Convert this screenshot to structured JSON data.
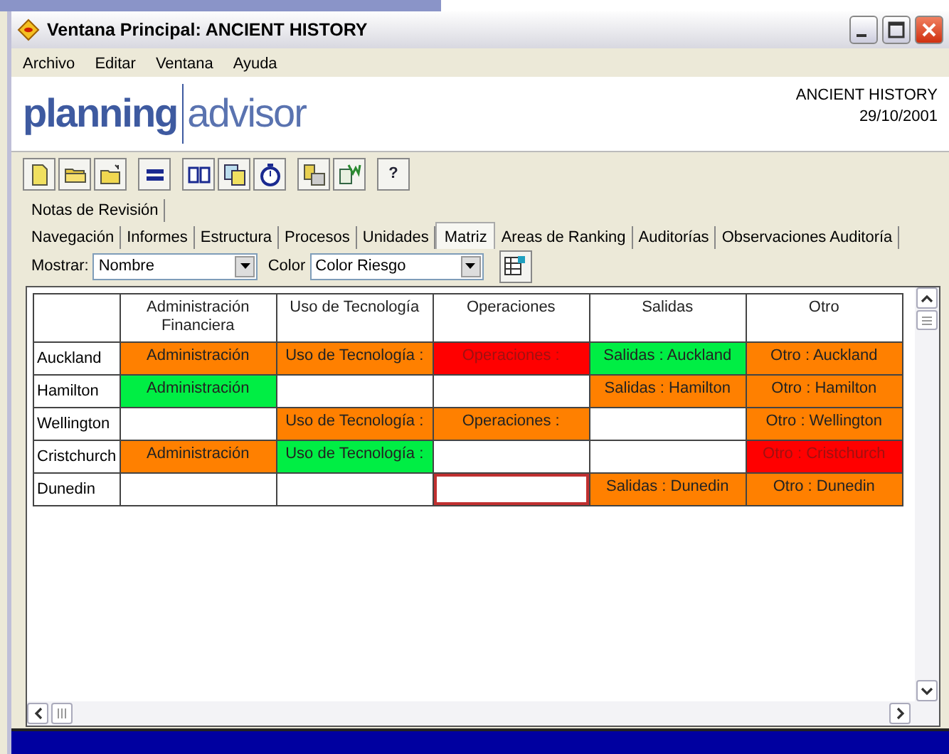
{
  "window": {
    "title": "Ventana Principal: ANCIENT HISTORY"
  },
  "menu": [
    "Archivo",
    "Editar",
    "Ventana",
    "Ayuda"
  ],
  "logo": {
    "left": "planning",
    "right": "advisor"
  },
  "header_info": [
    "ANCIENT HISTORY",
    "29/10/2001"
  ],
  "toolbar": [
    {
      "kind": "icon"
    },
    {
      "kind": "icon"
    },
    {
      "kind": "icon"
    },
    {
      "kind": "icon"
    },
    {
      "kind": "icon"
    },
    {
      "kind": "icon"
    },
    {
      "kind": "icon"
    },
    {
      "kind": "icon"
    },
    {
      "kind": "icon"
    },
    {
      "kind": "text",
      "label": "?"
    }
  ],
  "tabs_row1": [
    {
      "label": "Notas de Revisión",
      "selected": false
    }
  ],
  "tabs_row2": [
    {
      "label": "Navegación",
      "selected": false
    },
    {
      "label": "Informes",
      "selected": false
    },
    {
      "label": "Estructura",
      "selected": false
    },
    {
      "label": "Procesos",
      "selected": false
    },
    {
      "label": "Unidades",
      "selected": false
    },
    {
      "label": "Matriz",
      "selected": true
    },
    {
      "label": "Areas de Ranking",
      "selected": false
    },
    {
      "label": "Auditorías",
      "selected": false
    },
    {
      "label": "Observaciones Auditoría",
      "selected": false
    }
  ],
  "filters": {
    "show_label": "Mostrar:",
    "show_value": "Nombre",
    "color_label": "Color",
    "color_value": "Color Riesgo"
  },
  "matrix": {
    "columns": [
      "Administración Financiera",
      "Uso de Tecnología",
      "Operaciones",
      "Salidas",
      "Otro"
    ],
    "rows": [
      {
        "label": "Auckland",
        "cells": [
          {
            "text": "Administración",
            "color": "#ff8000",
            "selected": false
          },
          {
            "text": "Uso de Tecnología :",
            "color": "#ff8000",
            "selected": false
          },
          {
            "text": "Operaciones :",
            "color": "#ff0000",
            "selected": false
          },
          {
            "text": "Salidas : Auckland",
            "color": "#00ee44",
            "selected": false
          },
          {
            "text": "Otro : Auckland",
            "color": "#ff8000",
            "selected": false
          }
        ]
      },
      {
        "label": "Hamilton",
        "cells": [
          {
            "text": "Administración",
            "color": "#00ee44",
            "selected": false
          },
          {
            "selected": false
          },
          {
            "selected": false
          },
          {
            "text": "Salidas : Hamilton",
            "color": "#ff8000",
            "selected": false
          },
          {
            "text": "Otro : Hamilton",
            "color": "#ff8000",
            "selected": false
          }
        ]
      },
      {
        "label": "Wellington",
        "cells": [
          {
            "selected": false
          },
          {
            "text": "Uso de Tecnología :",
            "color": "#ff8000",
            "selected": false
          },
          {
            "text": "Operaciones :",
            "color": "#ff8000",
            "selected": false
          },
          {
            "selected": false
          },
          {
            "text": "Otro : Wellington",
            "color": "#ff8000",
            "selected": false
          }
        ]
      },
      {
        "label": "Cristchurch",
        "cells": [
          {
            "text": "Administración",
            "color": "#ff8000",
            "selected": false
          },
          {
            "text": "Uso de Tecnología :",
            "color": "#00ee44",
            "selected": false
          },
          {
            "selected": false
          },
          {
            "selected": false
          },
          {
            "text": "Otro : Cristchurch",
            "color": "#ff0000",
            "selected": false
          }
        ]
      },
      {
        "label": "Dunedin",
        "cells": [
          {
            "selected": false
          },
          {
            "selected": false
          },
          {
            "selected": true
          },
          {
            "text": "Salidas : Dunedin",
            "color": "#ff8000",
            "selected": false
          },
          {
            "text": "Otro : Dunedin",
            "color": "#ff8000",
            "selected": false
          }
        ]
      }
    ]
  }
}
